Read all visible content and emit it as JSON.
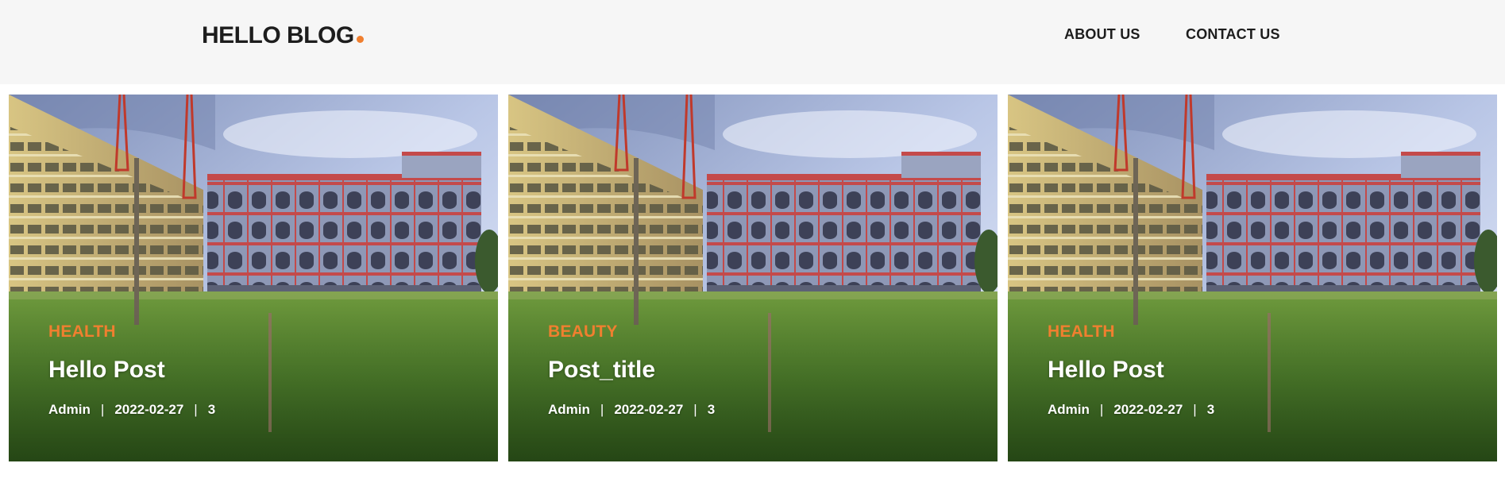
{
  "colors": {
    "accent": "#f07f2f",
    "nav_bg": "#f6f6f6",
    "text_dark": "#1d1d1d"
  },
  "header": {
    "brand": "HELLO BLOG",
    "nav": [
      {
        "label": "ABOUT US"
      },
      {
        "label": "CONTACT US"
      }
    ]
  },
  "posts": [
    {
      "category": "HEALTH",
      "title": "Hello Post",
      "author": "Admin",
      "date": "2022-02-27",
      "count": "3"
    },
    {
      "category": "BEAUTY",
      "title": "Post_title",
      "author": "Admin",
      "date": "2022-02-27",
      "count": "3"
    },
    {
      "category": "HEALTH",
      "title": "Hello Post",
      "author": "Admin",
      "date": "2022-02-27",
      "count": "3"
    }
  ]
}
